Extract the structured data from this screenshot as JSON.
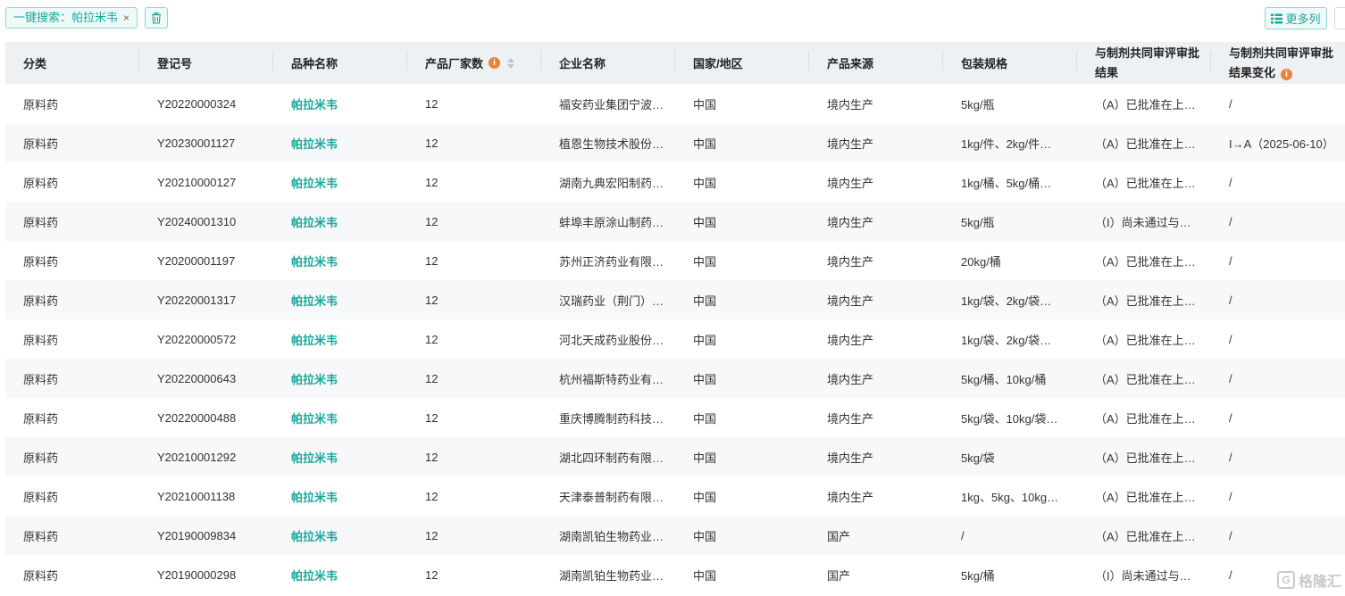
{
  "toolbar": {
    "search_tag": "一键搜索：帕拉米韦",
    "close_symbol": "×",
    "more_columns": "更多列",
    "accent_color": "#1aa89c"
  },
  "headers": {
    "category": "分类",
    "reg_no": "登记号",
    "variety": "品种名称",
    "maker_count": "产品厂家数",
    "company": "企业名称",
    "country": "国家/地区",
    "source": "产品来源",
    "package": "包装规格",
    "review_result_l1": "与制剂共同审评审批",
    "review_result_l2": "结果",
    "review_change_l1": "与制剂共同审评审批",
    "review_change_l2": "结果变化",
    "info_symbol": "i"
  },
  "rows": [
    {
      "category": "原料药",
      "reg_no": "Y20220000324",
      "variety": "帕拉米韦",
      "maker_count": "12",
      "company": "福安药业集团宁波…",
      "country": "中国",
      "source": "境内生产",
      "package": "5kg/瓶",
      "result": "（A）已批准在上…",
      "change": "/"
    },
    {
      "category": "原料药",
      "reg_no": "Y20230001127",
      "variety": "帕拉米韦",
      "maker_count": "12",
      "company": "植恩生物技术股份…",
      "country": "中国",
      "source": "境内生产",
      "package": "1kg/件、2kg/件…",
      "result": "（A）已批准在上…",
      "change": "I→A（2025-06-10）"
    },
    {
      "category": "原料药",
      "reg_no": "Y20210000127",
      "variety": "帕拉米韦",
      "maker_count": "12",
      "company": "湖南九典宏阳制药…",
      "country": "中国",
      "source": "境内生产",
      "package": "1kg/桶、5kg/桶…",
      "result": "（A）已批准在上…",
      "change": "/"
    },
    {
      "category": "原料药",
      "reg_no": "Y20240001310",
      "variety": "帕拉米韦",
      "maker_count": "12",
      "company": "蚌埠丰原涂山制药…",
      "country": "中国",
      "source": "境内生产",
      "package": "5kg/瓶",
      "result": "（I）尚未通过与…",
      "change": "/"
    },
    {
      "category": "原料药",
      "reg_no": "Y20200001197",
      "variety": "帕拉米韦",
      "maker_count": "12",
      "company": "苏州正济药业有限…",
      "country": "中国",
      "source": "境内生产",
      "package": "20kg/桶",
      "result": "（A）已批准在上…",
      "change": "/"
    },
    {
      "category": "原料药",
      "reg_no": "Y20220001317",
      "variety": "帕拉米韦",
      "maker_count": "12",
      "company": "汉瑞药业（荆门）…",
      "country": "中国",
      "source": "境内生产",
      "package": "1kg/袋、2kg/袋…",
      "result": "（A）已批准在上…",
      "change": "/"
    },
    {
      "category": "原料药",
      "reg_no": "Y20220000572",
      "variety": "帕拉米韦",
      "maker_count": "12",
      "company": "河北天成药业股份…",
      "country": "中国",
      "source": "境内生产",
      "package": "1kg/袋、2kg/袋…",
      "result": "（A）已批准在上…",
      "change": "/"
    },
    {
      "category": "原料药",
      "reg_no": "Y20220000643",
      "variety": "帕拉米韦",
      "maker_count": "12",
      "company": "杭州福斯特药业有…",
      "country": "中国",
      "source": "境内生产",
      "package": "5kg/桶、10kg/桶",
      "result": "（A）已批准在上…",
      "change": "/"
    },
    {
      "category": "原料药",
      "reg_no": "Y20220000488",
      "variety": "帕拉米韦",
      "maker_count": "12",
      "company": "重庆博腾制药科技…",
      "country": "中国",
      "source": "境内生产",
      "package": "5kg/袋、10kg/袋…",
      "result": "（A）已批准在上…",
      "change": "/"
    },
    {
      "category": "原料药",
      "reg_no": "Y20210001292",
      "variety": "帕拉米韦",
      "maker_count": "12",
      "company": "湖北四环制药有限…",
      "country": "中国",
      "source": "境内生产",
      "package": "5kg/袋",
      "result": "（A）已批准在上…",
      "change": "/"
    },
    {
      "category": "原料药",
      "reg_no": "Y20210001138",
      "variety": "帕拉米韦",
      "maker_count": "12",
      "company": "天津泰普制药有限…",
      "country": "中国",
      "source": "境内生产",
      "package": "1kg、5kg、10kg…",
      "result": "（A）已批准在上…",
      "change": "/"
    },
    {
      "category": "原料药",
      "reg_no": "Y20190009834",
      "variety": "帕拉米韦",
      "maker_count": "12",
      "company": "湖南凯铂生物药业…",
      "country": "中国",
      "source": "国产",
      "package": "/",
      "result": "（A）已批准在上…",
      "change": "/"
    },
    {
      "category": "原料药",
      "reg_no": "Y20190000298",
      "variety": "帕拉米韦",
      "maker_count": "12",
      "company": "湖南凯铂生物药业…",
      "country": "中国",
      "source": "国产",
      "package": "5kg/桶",
      "result": "（I）尚未通过与…",
      "change": "/"
    }
  ],
  "watermark": {
    "logo_char": "G",
    "text": "格隆汇"
  }
}
